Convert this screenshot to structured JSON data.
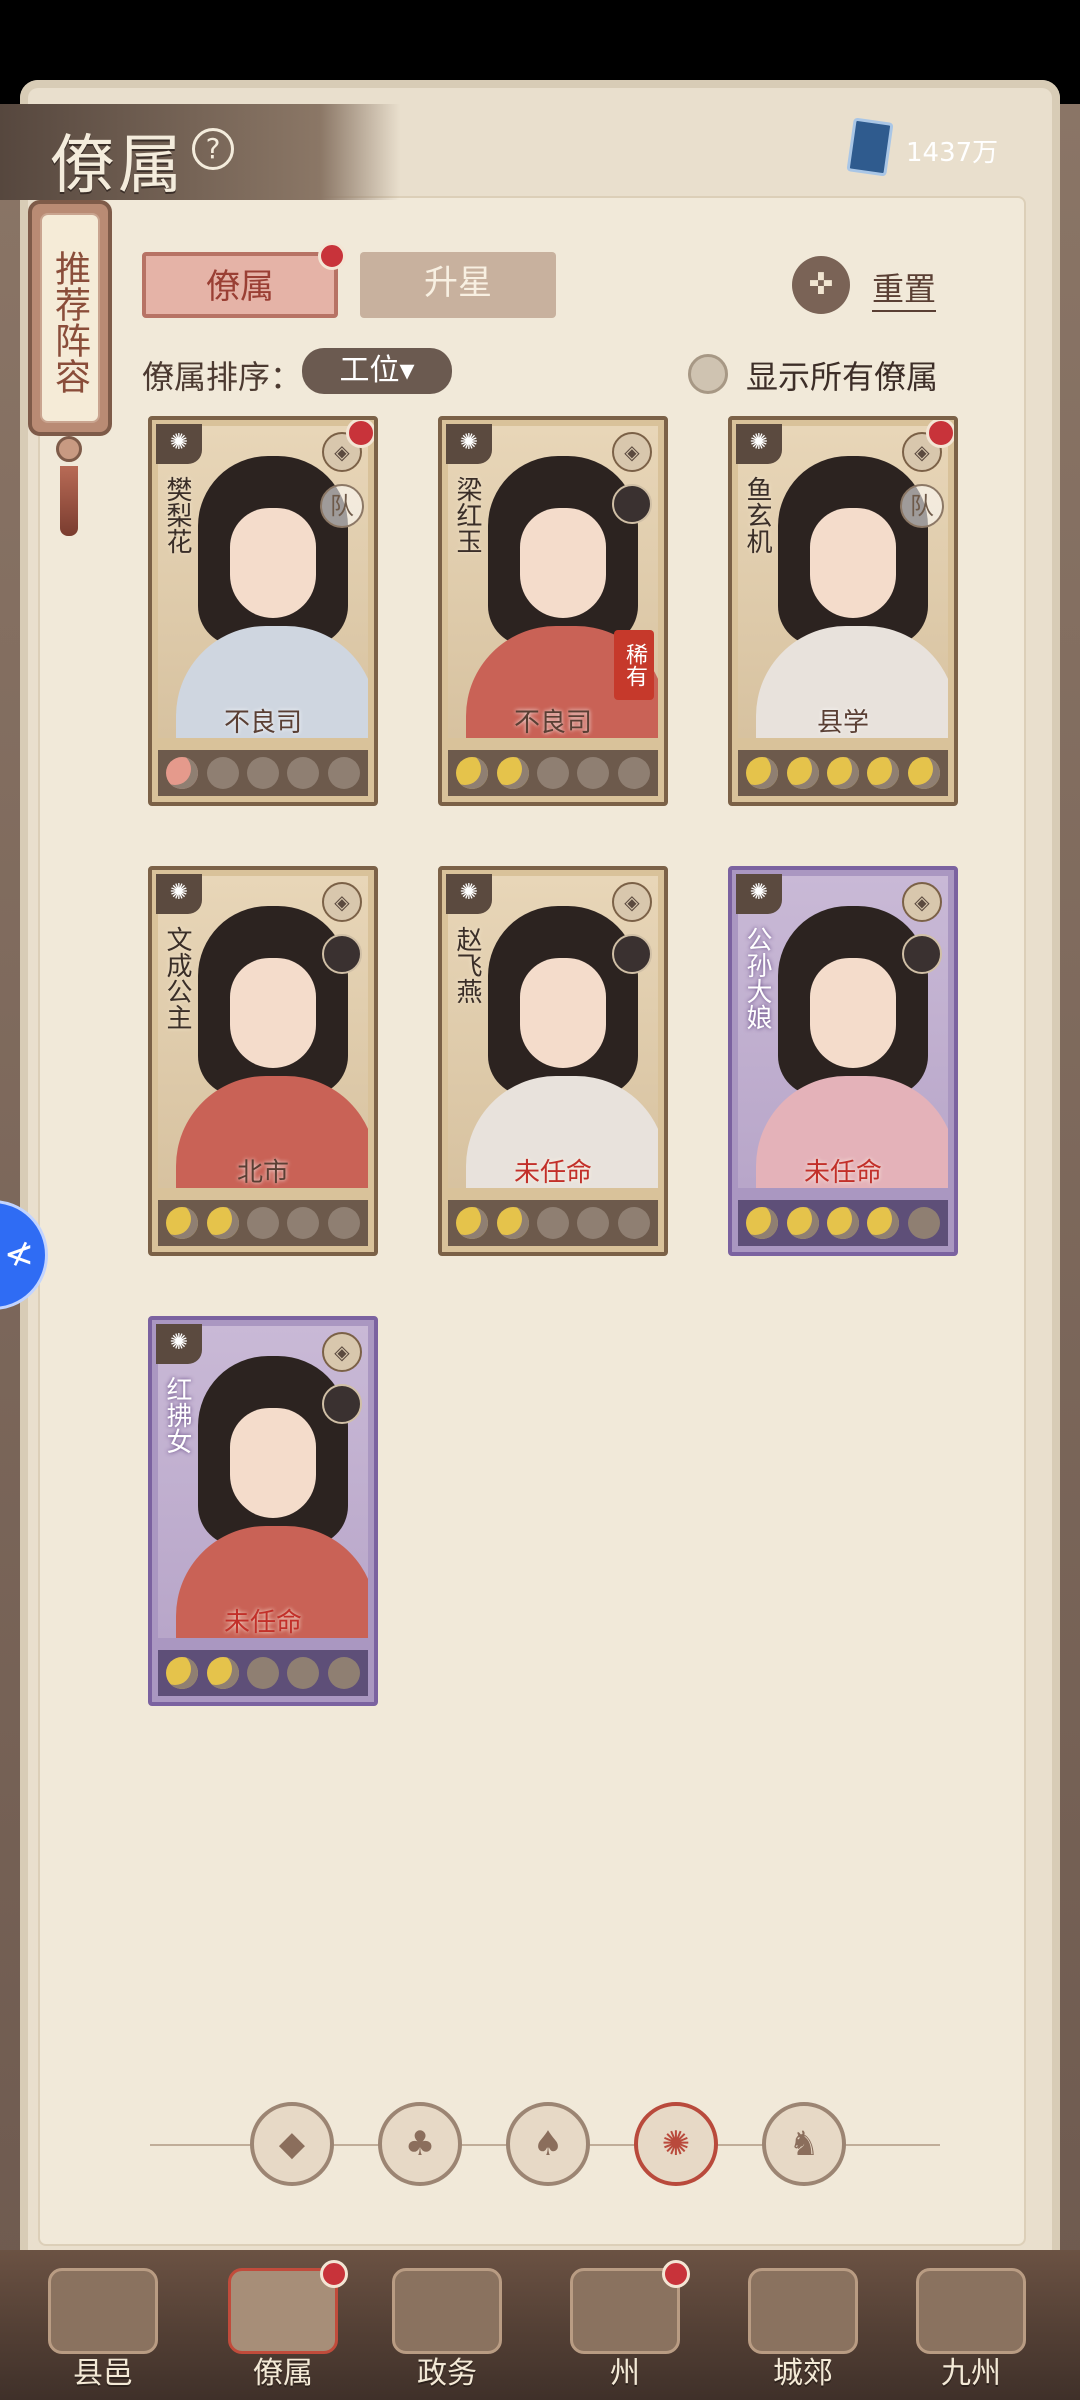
{
  "header": {
    "title": "僚属",
    "help_glyph": "?",
    "currency_value": "1437万"
  },
  "side_tag": {
    "label": "推荐阵容"
  },
  "tabs": [
    {
      "label": "僚属",
      "active": true,
      "has_dot": true
    },
    {
      "label": "升星",
      "active": false,
      "has_dot": false
    }
  ],
  "reset": {
    "label": "重置",
    "icon": "reset-icon"
  },
  "sort": {
    "label": "僚属排序：",
    "selected": "工位▾"
  },
  "show_all": {
    "label": "显示所有僚属",
    "checked": false
  },
  "cards": [
    {
      "name": "樊梨花",
      "post": "不良司",
      "rarity": "gold",
      "stars_on": 1,
      "star_color": "red",
      "team": "队",
      "rare": "",
      "has_dot": true,
      "role_icon": "shield-icon",
      "robe": "blue"
    },
    {
      "name": "梁红玉",
      "post": "不良司",
      "rarity": "gold",
      "stars_on": 2,
      "star_color": "gold",
      "team": "",
      "rare": "稀有",
      "has_dot": false,
      "role_icon": "shield-icon",
      "robe": "red"
    },
    {
      "name": "鱼玄机",
      "post": "县学",
      "rarity": "gold",
      "stars_on": 5,
      "star_color": "gold",
      "team": "队",
      "rare": "",
      "has_dot": true,
      "role_icon": "scroll-icon",
      "robe": "white"
    },
    {
      "name": "文成公主",
      "post": "北市",
      "rarity": "gold",
      "stars_on": 2,
      "star_color": "gold",
      "team": "",
      "rare": "",
      "has_dot": false,
      "role_icon": "coin-icon",
      "robe": "red"
    },
    {
      "name": "赵飞燕",
      "post": "未任命",
      "rarity": "gold",
      "stars_on": 2,
      "star_color": "gold",
      "team": "",
      "rare": "",
      "has_dot": false,
      "role_icon": "sword-icon",
      "robe": "white"
    },
    {
      "name": "公孙大娘",
      "post": "未任命",
      "rarity": "purple",
      "stars_on": 4,
      "star_color": "gold",
      "team": "",
      "rare": "",
      "has_dot": false,
      "role_icon": "sword-icon",
      "robe": "pink"
    },
    {
      "name": "红拂女",
      "post": "未任命",
      "rarity": "purple",
      "stars_on": 2,
      "star_color": "gold",
      "team": "",
      "rare": "",
      "has_dot": false,
      "role_icon": "yinyang-icon",
      "robe": "red"
    }
  ],
  "filters": [
    {
      "icon": "diamond-filter-icon",
      "glyph": "◆",
      "active": false
    },
    {
      "icon": "bell-filter-icon",
      "glyph": "♣",
      "active": false
    },
    {
      "icon": "gourd-filter-icon",
      "glyph": "♠",
      "active": false
    },
    {
      "icon": "fan-filter-icon",
      "glyph": "✺",
      "active": true
    },
    {
      "icon": "lion-filter-icon",
      "glyph": "♞",
      "active": false
    }
  ],
  "bottom_nav": [
    {
      "label": "县邑",
      "active": false,
      "has_dot": false
    },
    {
      "label": "僚属",
      "active": true,
      "has_dot": true
    },
    {
      "label": "政务",
      "active": false,
      "has_dot": false
    },
    {
      "label": "州",
      "active": false,
      "has_dot": true
    },
    {
      "label": "城郊",
      "active": false,
      "has_dot": false
    },
    {
      "label": "九州",
      "active": false,
      "has_dot": false
    }
  ],
  "edge_button": {
    "glyph": "≮",
    "icon": "assistant-bubble-icon"
  },
  "colors": {
    "accent": "#b94a3c",
    "dot": "#c8333a",
    "parchment": "#f1e9d9"
  }
}
